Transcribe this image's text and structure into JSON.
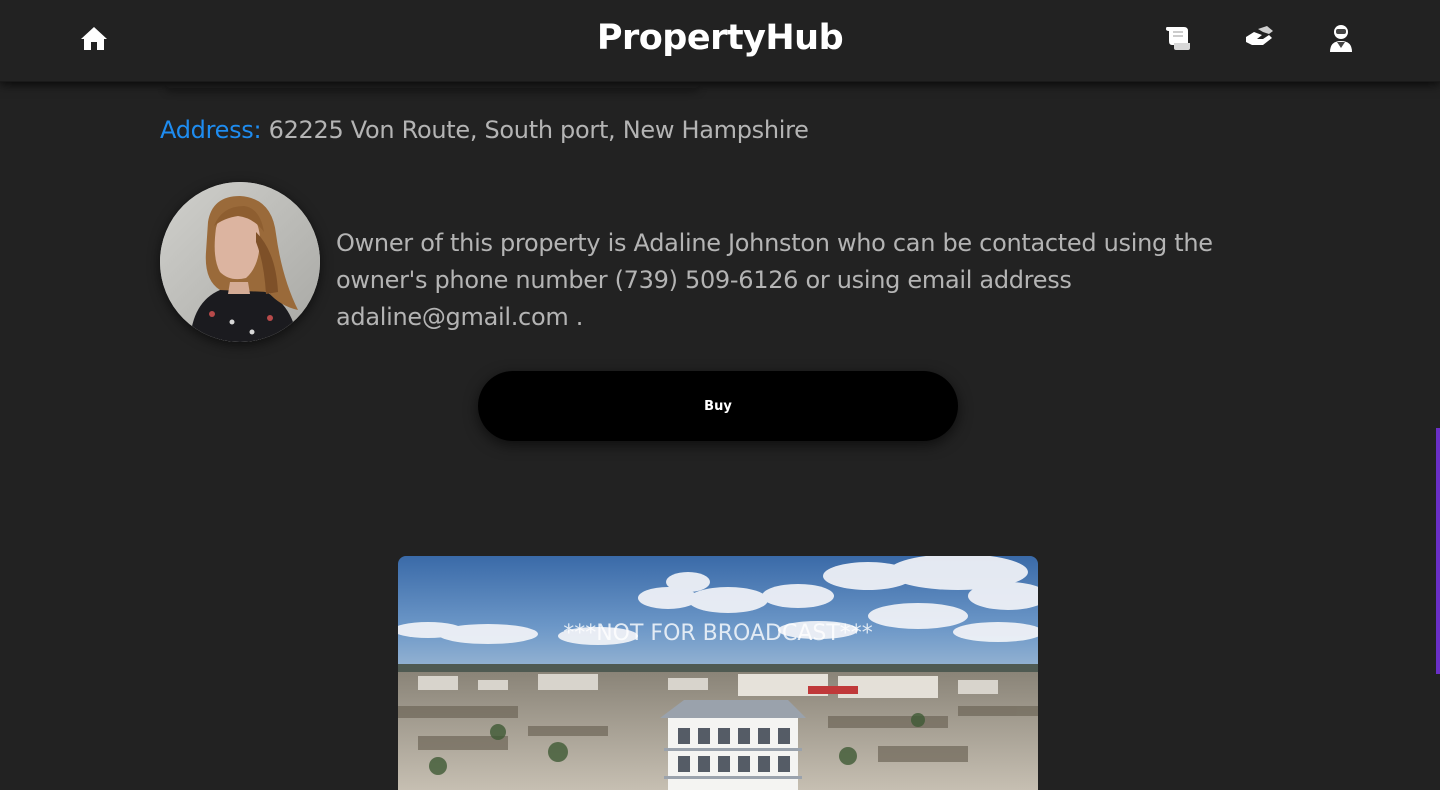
{
  "app": {
    "brand": "PropertyHub"
  },
  "nav": {
    "icons": [
      "home-icon",
      "listings-icon",
      "deals-icon",
      "profile-icon"
    ]
  },
  "property": {
    "address_label": "Address:",
    "address_value": " 62225 Von Route, South port, New Hampshire",
    "owner_text": "Owner of this property is Adaline Johnston who can be contacted using the owner's phone number (739) 509-6126 or using email address adaline@gmail.com .",
    "buy_label": "Buy",
    "image_watermark": "***NOT FOR BROADCAST***"
  },
  "colors": {
    "background": "#222222",
    "accent": "#1e8cf0",
    "text": "#b4b4b4",
    "button": "#000000",
    "scroll_accent": "#6a2fc6"
  }
}
